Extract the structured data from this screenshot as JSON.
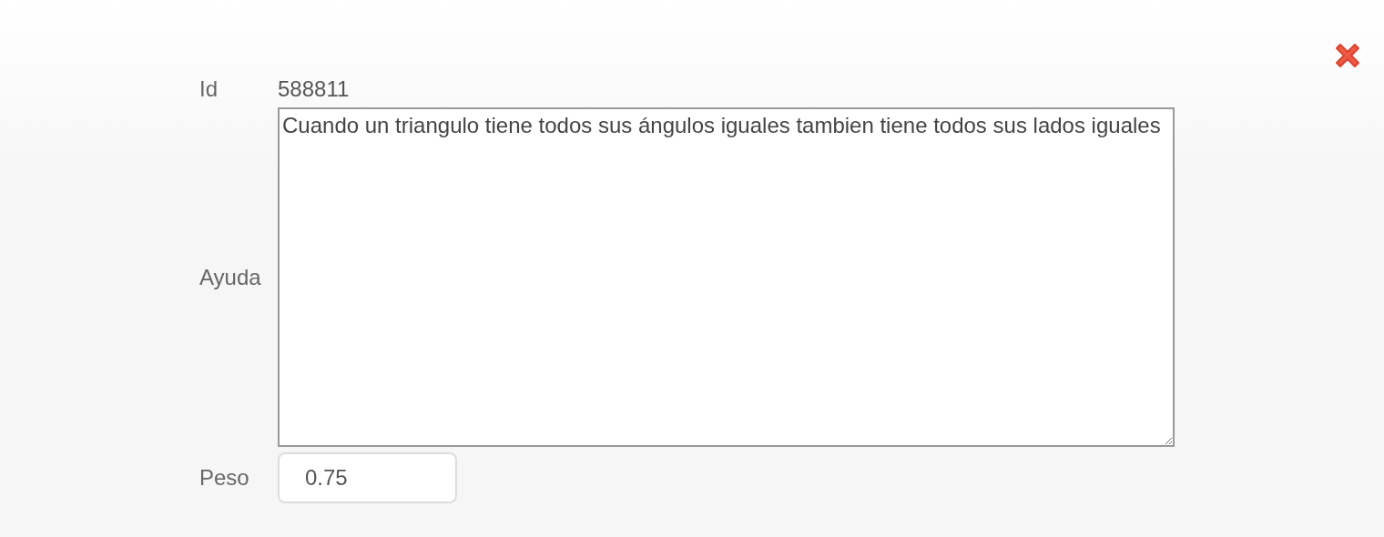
{
  "fields": [
    {
      "kind": "text",
      "label": "Id",
      "value": "588811"
    },
    {
      "kind": "textarea",
      "label": "Ayuda",
      "value": "Cuando un triangulo tiene todos sus ángulos iguales tambien tiene todos sus lados iguales"
    },
    {
      "kind": "input",
      "label": "Peso",
      "value": "0.75"
    }
  ]
}
